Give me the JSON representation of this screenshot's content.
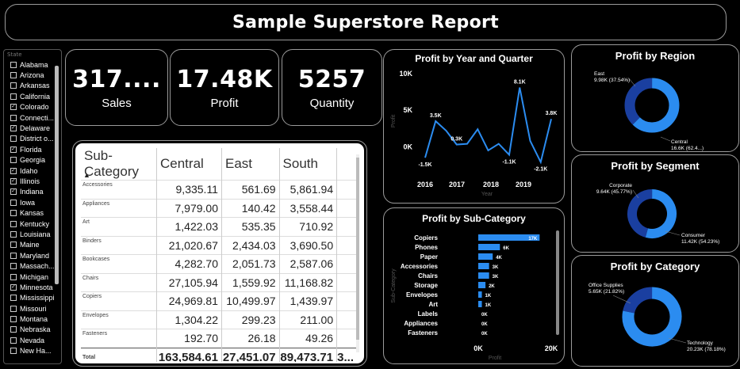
{
  "title": "Sample Superstore Report",
  "kpis": {
    "sales_value": "317....",
    "sales_label": "Sales",
    "profit_value": "17.48K",
    "profit_label": "Profit",
    "quantity_value": "5257",
    "quantity_label": "Quantity"
  },
  "slicer": {
    "header": "State",
    "items": [
      {
        "label": "Alabama",
        "checked": false
      },
      {
        "label": "Arizona",
        "checked": false
      },
      {
        "label": "Arkansas",
        "checked": false
      },
      {
        "label": "California",
        "checked": false
      },
      {
        "label": "Colorado",
        "checked": true
      },
      {
        "label": "Connecti...",
        "checked": false
      },
      {
        "label": "Delaware",
        "checked": true
      },
      {
        "label": "District o...",
        "checked": false
      },
      {
        "label": "Florida",
        "checked": true
      },
      {
        "label": "Georgia",
        "checked": false
      },
      {
        "label": "Idaho",
        "checked": true
      },
      {
        "label": "Illinois",
        "checked": true
      },
      {
        "label": "Indiana",
        "checked": true
      },
      {
        "label": "Iowa",
        "checked": false
      },
      {
        "label": "Kansas",
        "checked": false
      },
      {
        "label": "Kentucky",
        "checked": false
      },
      {
        "label": "Louisiana",
        "checked": false
      },
      {
        "label": "Maine",
        "checked": false
      },
      {
        "label": "Maryland",
        "checked": false
      },
      {
        "label": "Massach...",
        "checked": false
      },
      {
        "label": "Michigan",
        "checked": false
      },
      {
        "label": "Minnesota",
        "checked": true
      },
      {
        "label": "Mississippi",
        "checked": false
      },
      {
        "label": "Missouri",
        "checked": false
      },
      {
        "label": "Montana",
        "checked": false
      },
      {
        "label": "Nebraska",
        "checked": false
      },
      {
        "label": "Nevada",
        "checked": false
      },
      {
        "label": "New Ha...",
        "checked": false
      }
    ]
  },
  "table": {
    "headers": [
      "Sub-Category",
      "Central",
      "East",
      "South",
      ""
    ],
    "rows": [
      [
        "Accessories",
        "9,335.11",
        "561.69",
        "5,861.94"
      ],
      [
        "Appliances",
        "7,979.00",
        "140.42",
        "3,558.44"
      ],
      [
        "Art",
        "1,422.03",
        "535.35",
        "710.92"
      ],
      [
        "Binders",
        "21,020.67",
        "2,434.03",
        "3,690.50"
      ],
      [
        "Bookcases",
        "4,282.70",
        "2,051.73",
        "2,587.06"
      ],
      [
        "Chairs",
        "27,105.94",
        "1,559.92",
        "11,168.82"
      ],
      [
        "Copiers",
        "24,969.81",
        "10,499.97",
        "1,439.97"
      ],
      [
        "Envelopes",
        "1,304.22",
        "299.23",
        "211.00"
      ],
      [
        "Fasteners",
        "192.70",
        "26.18",
        "49.26"
      ]
    ],
    "total": [
      "Total",
      "163,584.61",
      "27,451.07",
      "89,473.71",
      "3..."
    ]
  },
  "colors": {
    "accent": "#2b8cf0",
    "dark_blue": "#1a3fa0",
    "background": "#000000"
  },
  "line_chart": {
    "title": "Profit by Year and Quarter",
    "xlabel": "Year",
    "ylabel": "Profit",
    "chart_data": {
      "type": "line",
      "x_ticks": [
        "2016",
        "2017",
        "2018",
        "2019"
      ],
      "y_ticks": [
        "0K",
        "5K",
        "10K"
      ],
      "ylim": [
        -3,
        10
      ],
      "values": [
        -1.5,
        3.5,
        2.2,
        0.3,
        0.4,
        2.4,
        -0.5,
        0.4,
        -1.1,
        8.1,
        0.8,
        -2.1,
        3.8
      ],
      "labels": [
        "-1.5K",
        "3.5K",
        "",
        "0.3K",
        "",
        "",
        "",
        "",
        "-1.1K",
        "8.1K",
        "",
        "-2.1K",
        "3.8K"
      ]
    }
  },
  "bar_chart": {
    "title": "Profit by Sub-Category",
    "xlabel": "Profit",
    "ylabel": "Sub-Category",
    "chart_data": {
      "type": "bar",
      "categories": [
        "Copiers",
        "Phones",
        "Paper",
        "Accessories",
        "Chairs",
        "Storage",
        "Envelopes",
        "Art",
        "Labels",
        "Appliances",
        "Fasteners"
      ],
      "values": [
        17,
        6,
        4,
        3,
        3,
        2,
        1,
        1,
        0,
        0,
        0
      ],
      "labels": [
        "17K",
        "6K",
        "4K",
        "3K",
        "3K",
        "2K",
        "1K",
        "1K",
        "0K",
        "0K",
        "0K"
      ],
      "x_ticks": [
        "0K",
        "20K"
      ],
      "xlim": [
        0,
        20
      ]
    }
  },
  "donuts": [
    {
      "title": "Profit by Region",
      "chart_data": {
        "type": "pie",
        "slices": [
          {
            "name": "East",
            "label": "9.98K (37.54%)",
            "value": 37.54
          },
          {
            "name": "Central",
            "label": "16.6K (62.4...)",
            "value": 62.46
          }
        ]
      }
    },
    {
      "title": "Profit by Segment",
      "chart_data": {
        "type": "pie",
        "slices": [
          {
            "name": "Corporate",
            "label": "9.64K (45.77%)",
            "value": 45.77
          },
          {
            "name": "Consumer",
            "label": "11.42K (54.23%)",
            "value": 54.23
          }
        ]
      }
    },
    {
      "title": "Profit by Category",
      "chart_data": {
        "type": "pie",
        "slices": [
          {
            "name": "Office Supplies",
            "label": "5.65K (21.82%)",
            "value": 21.82
          },
          {
            "name": "Technology",
            "label": "20.23K (78.18%)",
            "value": 78.18
          }
        ]
      }
    }
  ]
}
